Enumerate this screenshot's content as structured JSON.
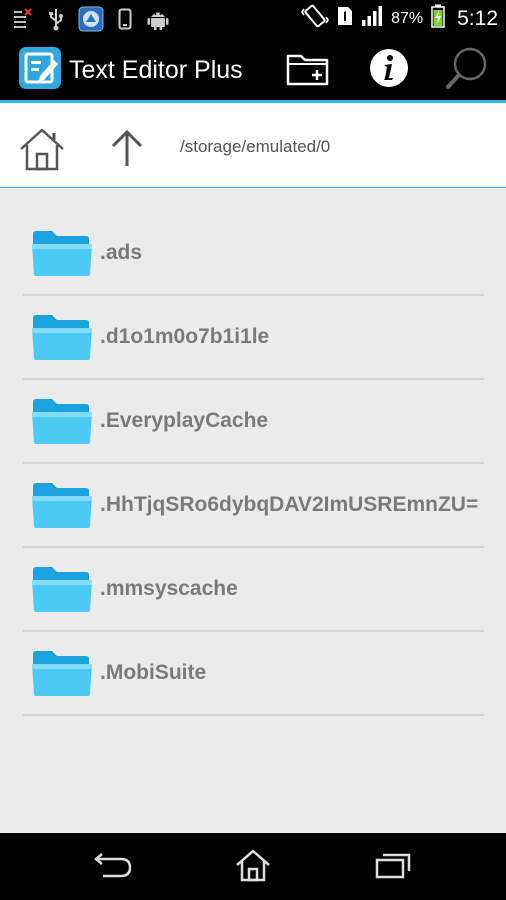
{
  "status_bar": {
    "battery_percent": "87%",
    "time": "5:12",
    "left_icons": [
      "notification-list-icon",
      "usb-icon",
      "app-notification-icon",
      "phone-icon",
      "android-icon"
    ],
    "right_icons": [
      "vibrate-icon",
      "sim-icon",
      "signal-icon",
      "battery-charging-icon"
    ]
  },
  "action_bar": {
    "title": "Text Editor Plus",
    "actions": [
      "new-folder-icon",
      "info-icon",
      "search-icon"
    ]
  },
  "path_bar": {
    "path": "/storage/emulated/0"
  },
  "folders": [
    {
      "name": ".ads"
    },
    {
      "name": ".d1o1m0o7b1i1le"
    },
    {
      "name": ".EveryplayCache"
    },
    {
      "name": ".HhTjqSRo6dybqDAV2ImUSREmnZU="
    },
    {
      "name": ".mmsyscache"
    },
    {
      "name": ".MobiSuite"
    }
  ],
  "nav_bar": {
    "buttons": [
      "back-icon",
      "home-icon",
      "recent-apps-icon"
    ]
  },
  "colors": {
    "accent": "#33b5e5",
    "folder": "#2fb7ea",
    "bar_background": "#000000",
    "list_background": "#ebebeb"
  }
}
